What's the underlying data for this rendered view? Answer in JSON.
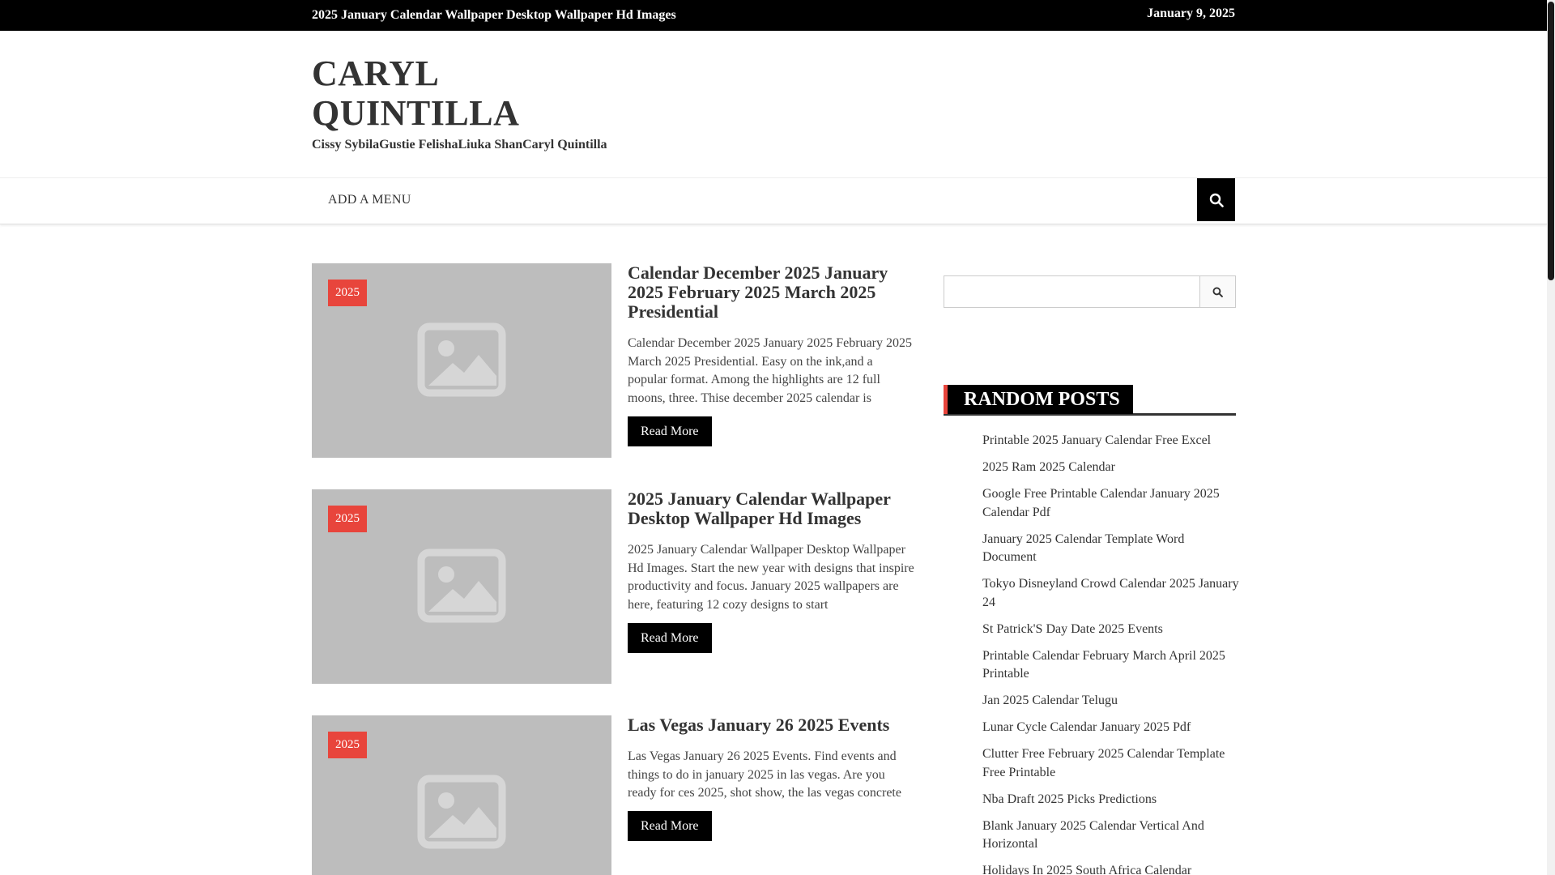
{
  "topbar": {
    "ticker": "2025 January Calendar Wallpaper Desktop Wallpaper Hd Images",
    "date": "January 9, 2025"
  },
  "site": {
    "title_line1": "CARYL",
    "title_line2": "QUINTILLA",
    "description": "Cissy SybilaGustie FelishaLiuka ShanCaryl Quintilla"
  },
  "nav": {
    "menu_label": "ADD A MENU",
    "search_icon": "search-icon"
  },
  "posts": [
    {
      "badge": "2025",
      "title": "Calendar December 2025 January 2025 February 2025 March 2025 Presidential",
      "excerpt": "Calendar December 2025 January 2025 February 2025 March 2025 Presidential. Easy on the ink,and a popular format. Among the highlights are 12 full moons, three. Thise december 2025 calendar is",
      "read_more": "Read More"
    },
    {
      "badge": "2025",
      "title": "2025 January Calendar Wallpaper Desktop Wallpaper Hd Images",
      "excerpt": "2025 January Calendar Wallpaper Desktop Wallpaper Hd Images. Start the new year with designs that inspire productivity and focus. January 2025 wallpapers are here, featuring 12 cozy designs to start",
      "read_more": "Read More"
    },
    {
      "badge": "2025",
      "title": "Las Vegas January 26 2025 Events",
      "excerpt": "Las Vegas January 26 2025 Events. Find events and things to do in january 2025 in las vegas. Are you ready for ces 2025, shot show, the las vegas concrete",
      "read_more": "Read More"
    }
  ],
  "sidebar": {
    "search_value": "",
    "search_placeholder": "",
    "random_posts_heading": "RANDOM POSTS",
    "random_posts": [
      "Printable 2025 January Calendar Free Excel",
      "2025 Ram 2025 Calendar",
      "Google Free Printable Calendar January 2025 Calendar Pdf",
      "January 2025 Calendar Template Word Document",
      "Tokyo Disneyland Crowd Calendar 2025 January 24",
      "St Patrick'S Day Date 2025 Events",
      "Printable Calendar February March April 2025 Printable",
      "Jan 2025 Calendar Telugu",
      "Lunar Cycle Calendar January 2025 Pdf",
      "Clutter Free February 2025 Calendar Template Free Printable",
      "Nba Draft 2025 Picks Predictions",
      "Blank January 2025 Calendar Vertical And Horizontal",
      "Holidays In 2025 South Africa Calendar"
    ]
  },
  "colors": {
    "accent_red": "#e8453c",
    "topbar_bg": "#000000",
    "thumb_placeholder": "#bdbdbd"
  }
}
